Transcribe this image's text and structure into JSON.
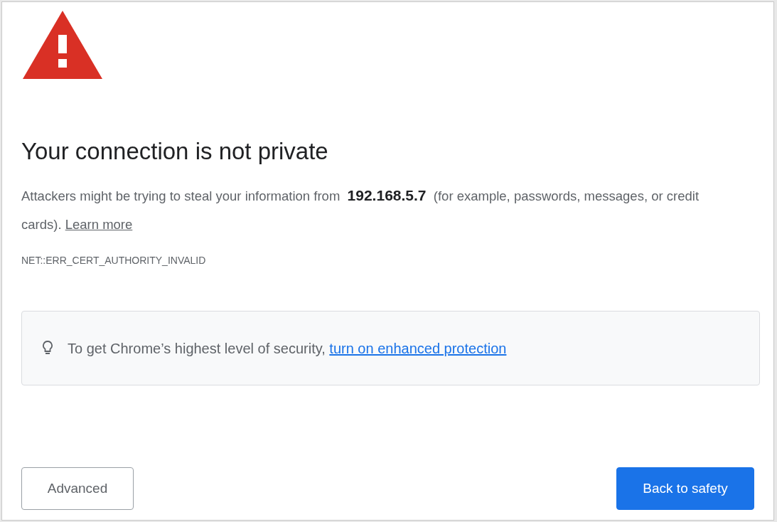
{
  "heading": "Your connection is not private",
  "message": {
    "text": "Attackers might be trying to steal your information from  **192.168.5.7**  (for example, passwords, messages, or credit cards).",
    "link": "Learn more"
  },
  "error_code": "NET::ERR_CERT_AUTHORITY_INVALID",
  "tip": {
    "text": "To get Chrome’s highest level of security,",
    "link": "turn on enhanced protection"
  },
  "buttons": [
    {
      "label": "Advanced",
      "kind": "secondary"
    },
    {
      "label": "Back to safety",
      "kind": "primary"
    }
  ]
}
